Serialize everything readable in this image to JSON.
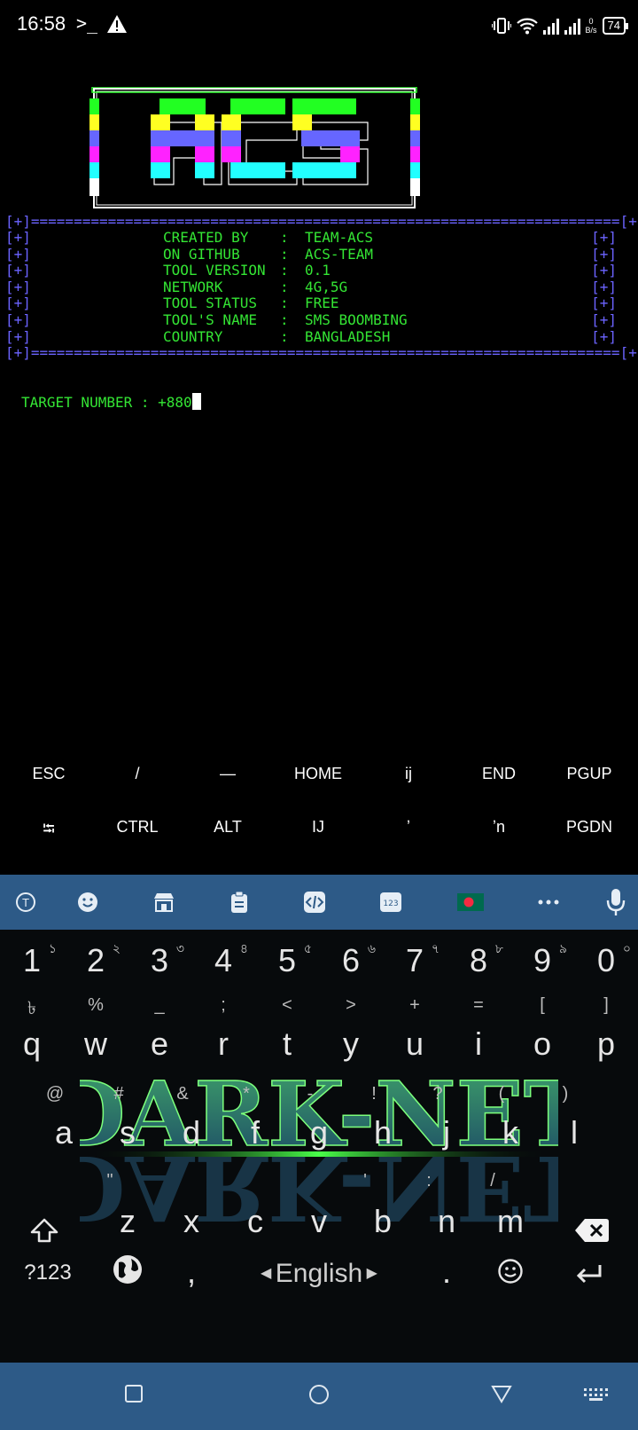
{
  "status_bar": {
    "time": "16:58",
    "prompt_glyph": ">_",
    "net_speed_value": "0",
    "net_speed_unit": "B/s",
    "battery": "74"
  },
  "terminal": {
    "logo_text": "ACS",
    "separator": "[+]=====================================================================[+]",
    "bracket": "[+]",
    "colon": ":",
    "info": [
      {
        "key": "CREATED BY",
        "value": "TEAM-ACS"
      },
      {
        "key": "ON GITHUB",
        "value": "ACS-TEAM"
      },
      {
        "key": "TOOL VERSION",
        "value": "0.1"
      },
      {
        "key": "NETWORK",
        "value": "4G,5G"
      },
      {
        "key": "TOOL STATUS",
        "value": "FREE"
      },
      {
        "key": "TOOL'S NAME",
        "value": "SMS BOOMBING"
      },
      {
        "key": "COUNTRY",
        "value": "BANGLADESH"
      }
    ],
    "prompt_text": "TARGET NUMBER : +880"
  },
  "extra_keys": {
    "row1": [
      "ESC",
      "/",
      "—",
      "HOME",
      "ij",
      "END",
      "PGUP"
    ],
    "row2": [
      "⭾",
      "CTRL",
      "ALT",
      "IJ",
      "ʼ",
      "ʼn",
      "PGDN"
    ]
  },
  "keyboard": {
    "numbers": [
      "1",
      "2",
      "3",
      "4",
      "5",
      "6",
      "7",
      "8",
      "9",
      "0"
    ],
    "bengali_digits": [
      "১",
      "২",
      "৩",
      "৪",
      "৫",
      "৬",
      "৭",
      "৮",
      "৯",
      "০"
    ],
    "row_q_symbols": [
      "৳",
      "%",
      "_",
      ";",
      "<",
      ">",
      "+",
      "=",
      "[",
      "]"
    ],
    "row_q": [
      "q",
      "w",
      "e",
      "r",
      "t",
      "y",
      "u",
      "i",
      "o",
      "p"
    ],
    "row_a_symbols": [
      "@",
      "#",
      "&",
      "*",
      "-",
      "!",
      "?",
      "(",
      ")"
    ],
    "row_a": [
      "a",
      "s",
      "d",
      "f",
      "g",
      "h",
      "j",
      "k",
      "l"
    ],
    "row_z_symbols": [
      "\"",
      "'",
      ":",
      "/"
    ],
    "row_z": [
      "z",
      "x",
      "c",
      "v",
      "b",
      "n",
      "m"
    ],
    "symbols_key": "?123",
    "comma": ",",
    "language": "English",
    "period": ".",
    "theme_text": "DARK-NET"
  },
  "colors": {
    "green": "#34e534",
    "blue": "#6b63ff",
    "toolbar": "#2d5a87"
  }
}
